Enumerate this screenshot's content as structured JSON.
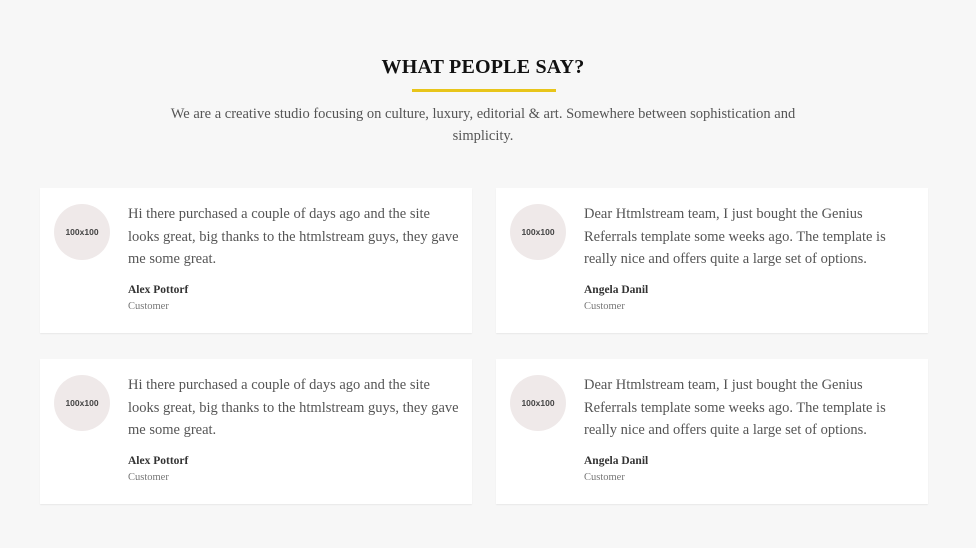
{
  "section": {
    "title": "WHAT PEOPLE SAY?",
    "intro": "We are a creative studio focusing on culture, luxury, editorial & art. Somewhere between sophistication and simplicity.",
    "accent_color": "#e8c51a"
  },
  "testimonials": [
    {
      "avatar_placeholder": "100x100",
      "quote": "Hi there purchased a couple of days ago and the site looks great, big thanks to the htmlstream guys, they gave me some great.",
      "author": "Alex Pottorf",
      "role": "Customer"
    },
    {
      "avatar_placeholder": "100x100",
      "quote": "Dear Htmlstream team, I just bought the Genius Referrals template some weeks ago. The template is really nice and offers quite a large set of options.",
      "author": "Angela Danil",
      "role": "Customer"
    },
    {
      "avatar_placeholder": "100x100",
      "quote": "Hi there purchased a couple of days ago and the site looks great, big thanks to the htmlstream guys, they gave me some great.",
      "author": "Alex Pottorf",
      "role": "Customer"
    },
    {
      "avatar_placeholder": "100x100",
      "quote": "Dear Htmlstream team, I just bought the Genius Referrals template some weeks ago. The template is really nice and offers quite a large set of options.",
      "author": "Angela Danil",
      "role": "Customer"
    }
  ]
}
